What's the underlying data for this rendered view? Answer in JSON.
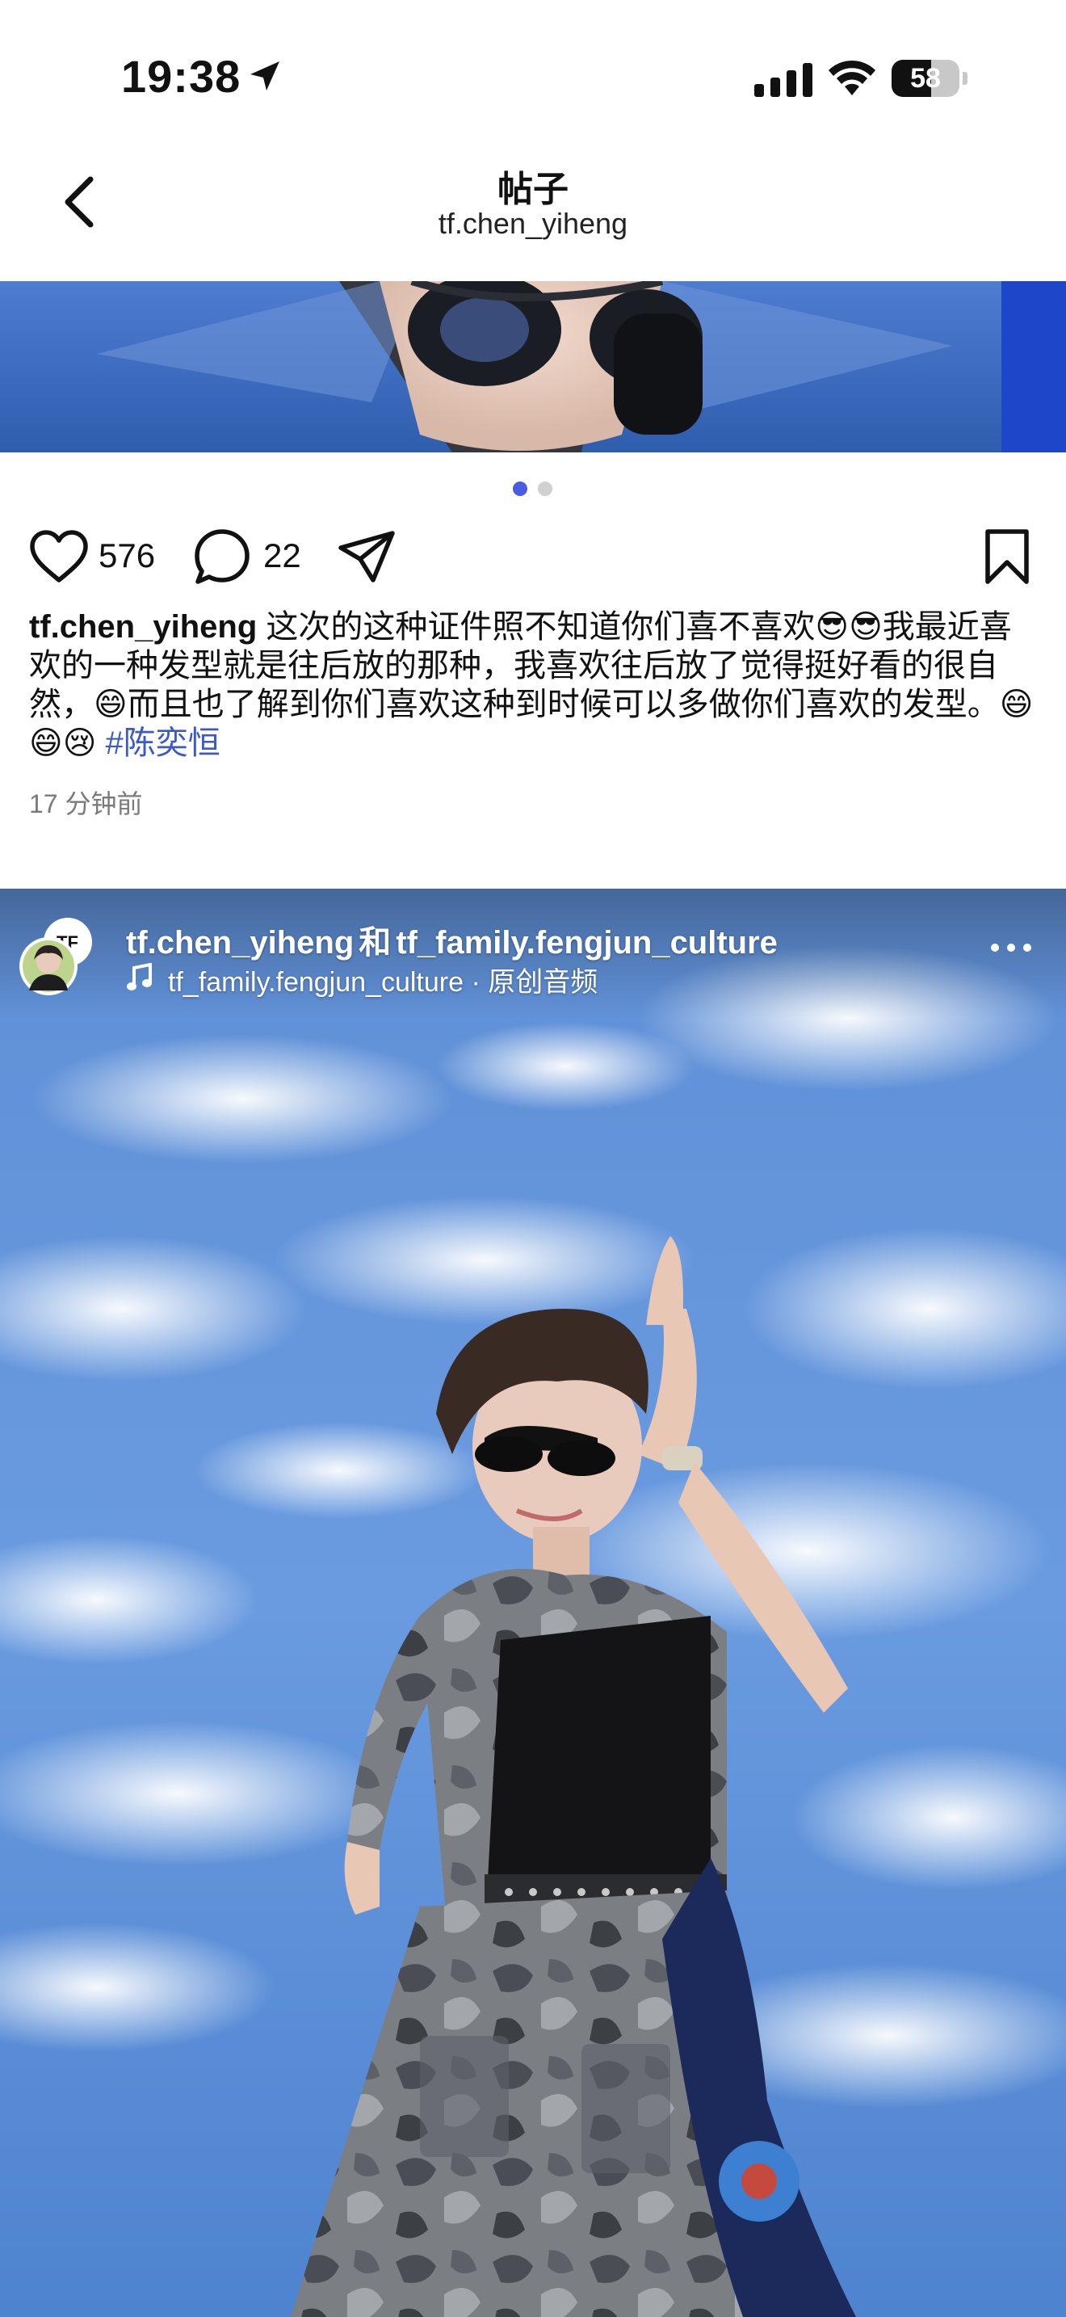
{
  "status_bar": {
    "time": "19:38",
    "battery_level": "58",
    "battery_fraction": 0.58,
    "icons": [
      "location-arrow-icon",
      "signal-bars-icon",
      "wifi-icon",
      "battery-icon"
    ]
  },
  "header": {
    "title": "帖子",
    "subtitle": "tf.chen_yiheng",
    "back_icon": "chevron-left-icon"
  },
  "post": {
    "carousel": {
      "total": 2,
      "active_index": 0,
      "active_color": "#4a5de0",
      "inactive_color": "#d0d0d0"
    },
    "actions": {
      "like_count": "576",
      "comment_count": "22",
      "icons": [
        "heart-icon",
        "comment-icon",
        "share-icon",
        "bookmark-icon"
      ]
    },
    "caption": {
      "username": "tf.chen_yiheng",
      "text": "这次的这种证件照不知道你们喜不喜欢😎😎我最近喜欢的一种发型就是往后放的那种，我喜欢往后放了觉得挺好看的很自然，😄而且也了解到你们喜欢这种到时候可以多做你们喜欢的发型。😄😄😢",
      "hashtag": "#陈奕恒"
    },
    "timestamp": "17 分钟前"
  },
  "video_post": {
    "collab_user_1": "tf.chen_yiheng",
    "collab_joiner": "和",
    "collab_user_2": "tf_family.fengjun_culture",
    "audio_account": "tf_family.fengjun_culture",
    "audio_separator": " · ",
    "audio_label": "原创音频",
    "icons": [
      "music-note-icon",
      "more-dots-icon"
    ]
  },
  "colors": {
    "hashtag": "#3b5ac8",
    "timestamp": "#7a7a7a",
    "sky_top": "#6d9be0",
    "sky_bottom": "#4f86d4"
  }
}
